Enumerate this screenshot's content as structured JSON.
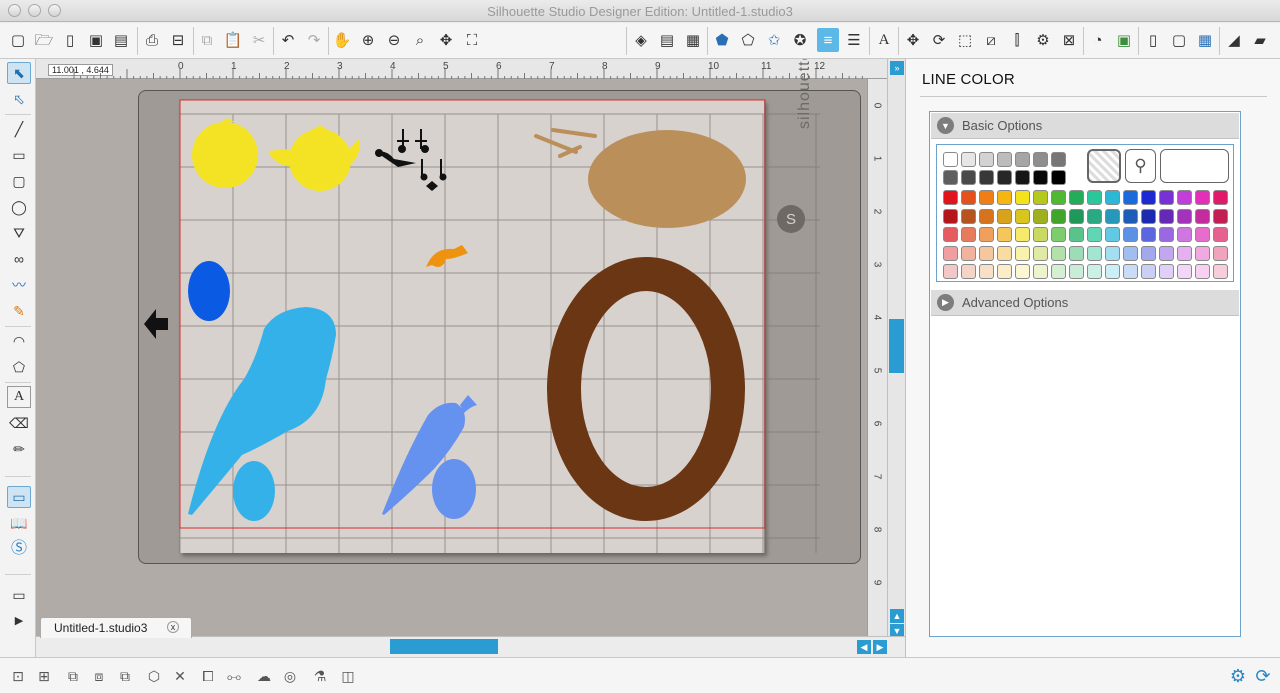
{
  "window": {
    "title": "Silhouette Studio Designer Edition: Untitled-1.studio3"
  },
  "toolbar": {
    "icons": [
      "new-doc",
      "open",
      "new-page",
      "save",
      "save-library",
      "print",
      "print-cut",
      "copy",
      "paste",
      "cut",
      "undo",
      "redo",
      "pan",
      "zoom-in",
      "zoom-out",
      "zoom-select",
      "zoom-fit",
      "fit-to-page",
      "fill-color",
      "fill-gradient",
      "fill-pattern",
      "line-color",
      "line-style",
      "text-style",
      "transform",
      "offset",
      "page-setup",
      "cut-settings",
      "send",
      "knife",
      "eraser"
    ]
  },
  "canvas": {
    "coordinate_readout": "11.001 , 4.644",
    "ruler_h_labels": [
      "0",
      "1",
      "2",
      "3",
      "4",
      "5",
      "6",
      "7",
      "8",
      "9",
      "10",
      "11",
      "12"
    ],
    "ruler_v_labels": [
      "0",
      "1",
      "2",
      "3",
      "4",
      "5",
      "6",
      "7",
      "8",
      "9"
    ],
    "mat_brand": "silhouette",
    "colors": {
      "canvas_bg": "#b0aba7",
      "mat": "#a09a96",
      "paper": "#d7d2ce",
      "chick_yellow": "#f3e324",
      "nest_brown": "#6b3614",
      "egg_brown": "#bb8f5a",
      "bird_blue": "#35b1ea",
      "bird_light_blue": "#6692ef",
      "egg_dark_blue": "#0a5ae4",
      "orange": "#ee9210"
    }
  },
  "document_tab": {
    "label": "Untitled-1.studio3",
    "close_symbol": "x"
  },
  "right_panel": {
    "title": "LINE COLOR",
    "basic_options_label": "Basic Options",
    "advanced_options_label": "Advanced Options",
    "palette": [
      [
        "#ffffff",
        "#e6e6e6",
        "#d2d2d2",
        "#bcbcbc",
        "#a5a5a5",
        "#8e8e8e",
        "#767676"
      ],
      [
        "#5e5e5e",
        "#4a4a4a",
        "#383838",
        "#272727",
        "#161616",
        "#080808",
        "#000000"
      ],
      [
        "#e2141b",
        "#e3511c",
        "#ef7e14",
        "#f6b612",
        "#f4e31b",
        "#b6c81c",
        "#50b932",
        "#23ad58",
        "#2ac79a",
        "#2db7d6",
        "#1b6bdb",
        "#1d2ad3",
        "#7931d6",
        "#c13ed8",
        "#e231b8",
        "#e11b69"
      ],
      [
        "#b5161b",
        "#b6531f",
        "#d7731c",
        "#d7a31c",
        "#d8c51e",
        "#9fb01f",
        "#41a52c",
        "#20985a",
        "#2aaa83",
        "#2699ba",
        "#1d5cb9",
        "#1b2bb0",
        "#6629b5",
        "#a332bd",
        "#c32c9d",
        "#c22055"
      ],
      [
        "#e65b60",
        "#e77b5c",
        "#f19f5d",
        "#f6c65d",
        "#f6ea6a",
        "#cad961",
        "#7ccd6b",
        "#58c38a",
        "#60d6b5",
        "#62c9e3",
        "#5c92e5",
        "#5b66df",
        "#9a68e0",
        "#d076e3",
        "#e86ccb",
        "#e6618f"
      ],
      [
        "#f09ea0",
        "#f1b29e",
        "#f6c69f",
        "#f9dca0",
        "#f9f2aa",
        "#e0eaa4",
        "#b2e1aa",
        "#9cdcb6",
        "#a2e6d1",
        "#a3dff0",
        "#a0bff0",
        "#a1a8ed",
        "#c2a6ee",
        "#e6b0f0",
        "#f1a9e1",
        "#f1a3bd"
      ],
      [
        "#f2c7c8",
        "#f3d4c6",
        "#f8e0c6",
        "#fbedc8",
        "#fbf7d2",
        "#ecf3cd",
        "#d4efd1",
        "#c8ecd8",
        "#cbf1e6",
        "#cbefF7",
        "#c9dbf7",
        "#cacff6",
        "#ded0f6",
        "#f2d6f7",
        "#f7d1ef",
        "#f7cdda"
      ]
    ]
  },
  "bottom_tools": {
    "icons": [
      "group",
      "ungroup",
      "compound",
      "release",
      "duplicate",
      "delete",
      "bring-front",
      "send-back",
      "weld",
      "offset",
      "trace",
      "library"
    ]
  }
}
